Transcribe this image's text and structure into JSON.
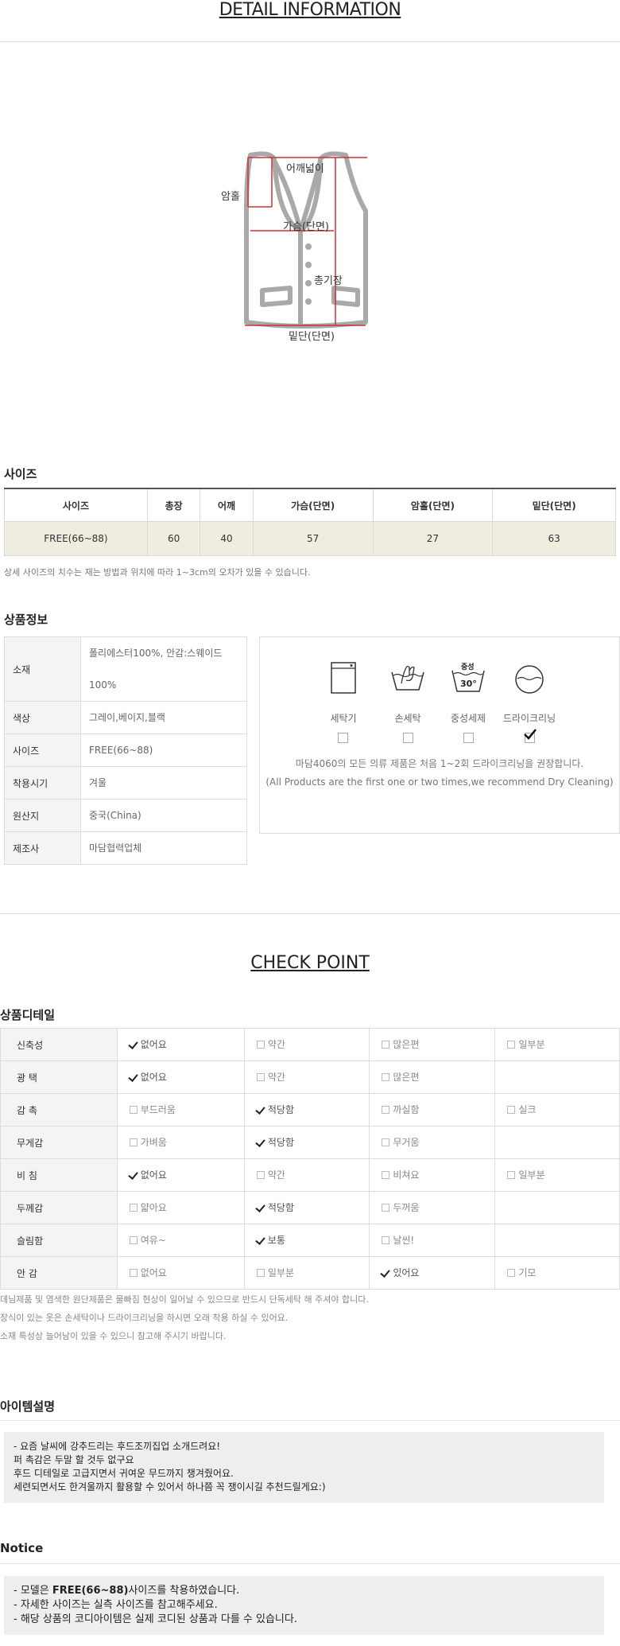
{
  "detail": {
    "title": "DETAIL INFORMATION",
    "diagram_labels": {
      "shoulder": "어깨넓이",
      "armhole": "암홀",
      "chest": "가슴(단면)",
      "length": "총기장",
      "hem": "밑단(단면)"
    }
  },
  "size": {
    "heading": "사이즈",
    "headers": [
      "사이즈",
      "총장",
      "어깨",
      "가슴(단면)",
      "암홀(단면)",
      "밑단(단면)"
    ],
    "row": [
      "FREE(66~88)",
      "60",
      "40",
      "57",
      "27",
      "63"
    ],
    "note": "상세 사이즈의 치수는 재는 방법과 위치에 따라 1~3cm의 오차가 있을 수 있습니다."
  },
  "product": {
    "heading": "상품정보",
    "rows": [
      {
        "key": "소재",
        "value": "폴리에스터100%, 안감:스웨이드100%"
      },
      {
        "key": "색상",
        "value": "그레이,베이지,블랙"
      },
      {
        "key": "사이즈",
        "value": "FREE(66~88)"
      },
      {
        "key": "착용시기",
        "value": "겨울"
      },
      {
        "key": "원산지",
        "value": "중국(China)"
      },
      {
        "key": "제조사",
        "value": "마담협력업체"
      }
    ],
    "care": {
      "items": [
        "세탁기",
        "손세탁",
        "중성세제",
        "드라이크리닝"
      ],
      "selected_index": 3,
      "neutral_label": "중성",
      "temp_label": "30°",
      "line1": "마담4060의 모든 의류 제품은 처음 1~2회 드라이크리닝을 권장합니다.",
      "line2": "(All Products are the first one or two times,we recommend Dry Cleaning)"
    }
  },
  "check": {
    "title": "CHECK POINT",
    "heading": "상품디테일",
    "rows": [
      {
        "key": "신축성",
        "options": [
          "없어요",
          "약간",
          "많은편",
          "일부분"
        ],
        "selected": 0
      },
      {
        "key": "광 택",
        "options": [
          "없어요",
          "약간",
          "많은편"
        ],
        "selected": 0
      },
      {
        "key": "감 촉",
        "options": [
          "부드러움",
          "적당함",
          "까실함",
          "실크"
        ],
        "selected": 1
      },
      {
        "key": "무게감",
        "options": [
          "가벼움",
          "적당함",
          "무거움"
        ],
        "selected": 1
      },
      {
        "key": "비 침",
        "options": [
          "없어요",
          "약간",
          "비쳐요",
          "일부분"
        ],
        "selected": 0
      },
      {
        "key": "두께감",
        "options": [
          "얇아요",
          "적당함",
          "두꺼움"
        ],
        "selected": 1
      },
      {
        "key": "슬림함",
        "options": [
          "여유~",
          "보통",
          "날씬!"
        ],
        "selected": 1
      },
      {
        "key": "안 감",
        "options": [
          "없어요",
          "일부분",
          "있어요",
          "기모"
        ],
        "selected": 2
      }
    ],
    "notes": [
      "데님제품 및 염색한 원단제품은 물빠짐 현상이 일어날 수 있으므로 반드시 단독세탁 해 주셔야 합니다.",
      "장식이 있는 옷은 손세탁이나 드라이크리닝을 하시면 오래 착용 하실 수 있어요.",
      "소재 특성상 늘어남이 있을 수 있으니 참고해 주시기 바랍니다."
    ]
  },
  "item": {
    "heading": "아이템설명",
    "lines": [
      "- 요즘 날씨에 강추드리는 후드조끼집업 소개드려요!",
      "퍼 촉감은 두말 할 것두 없구요",
      "후드 디테일로 고급지면서 귀여운 무드까지 챙겨줬어요.",
      "세련되면서도 한겨울까지 활용할 수 있어서 하나쯤 꼭 쟁이시길 추천드릴게요:)"
    ]
  },
  "notice": {
    "heading": "Notice",
    "line1_pre": "- 모델은 ",
    "line1_bold": "FREE(66~88)",
    "line1_post": "사이즈를 착용하였습니다.",
    "line2": "- 자세한 사이즈는 실측 사이즈를 참고해주세요.",
    "line3": "- 해당 상품의 코디아이템은 실제 코디된 상품과 다를 수 있습니다."
  }
}
